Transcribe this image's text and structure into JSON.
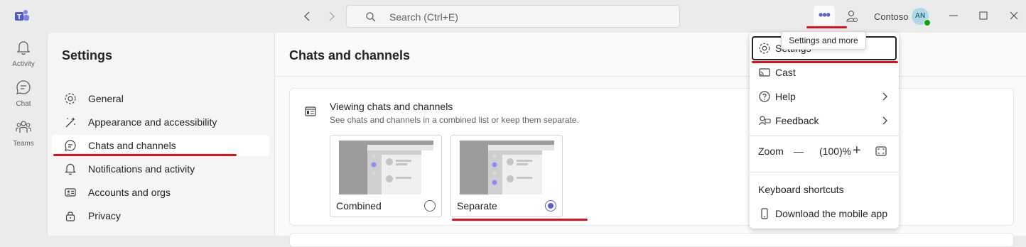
{
  "titlebar": {
    "search_placeholder": "Search (Ctrl+E)",
    "org_name": "Contoso",
    "avatar_initials": "AN",
    "more_label": "•••"
  },
  "rail": {
    "items": [
      {
        "label": "Activity",
        "icon": "bell-icon"
      },
      {
        "label": "Chat",
        "icon": "chat-icon"
      },
      {
        "label": "Teams",
        "icon": "teams-icon"
      }
    ]
  },
  "settings_nav": {
    "title": "Settings",
    "items": [
      {
        "label": "General",
        "icon": "gear-icon"
      },
      {
        "label": "Appearance and accessibility",
        "icon": "wand-icon"
      },
      {
        "label": "Chats and channels",
        "icon": "chat-icon",
        "selected": true
      },
      {
        "label": "Notifications and activity",
        "icon": "bell-icon"
      },
      {
        "label": "Accounts and orgs",
        "icon": "id-card-icon"
      },
      {
        "label": "Privacy",
        "icon": "lock-icon"
      }
    ]
  },
  "main": {
    "title": "Chats and channels",
    "card": {
      "title": "Viewing chats and channels",
      "subtitle": "See chats and channels in a combined list or keep them separate.",
      "options": [
        {
          "label": "Combined",
          "selected": false
        },
        {
          "label": "Separate",
          "selected": true
        }
      ]
    }
  },
  "tooltip": "Settings and more",
  "menu": {
    "settings": "Settings",
    "cast": "Cast",
    "help": "Help",
    "feedback": "Feedback",
    "zoom_label": "Zoom",
    "zoom_minus": "—",
    "zoom_value": "(100)%",
    "zoom_plus": "+",
    "keyboard_shortcuts": "Keyboard shortcuts",
    "download_app": "Download the mobile app"
  },
  "colors": {
    "brand": "#5b5fc7",
    "annotation": "#e2101e",
    "presence": "#13a10e"
  }
}
